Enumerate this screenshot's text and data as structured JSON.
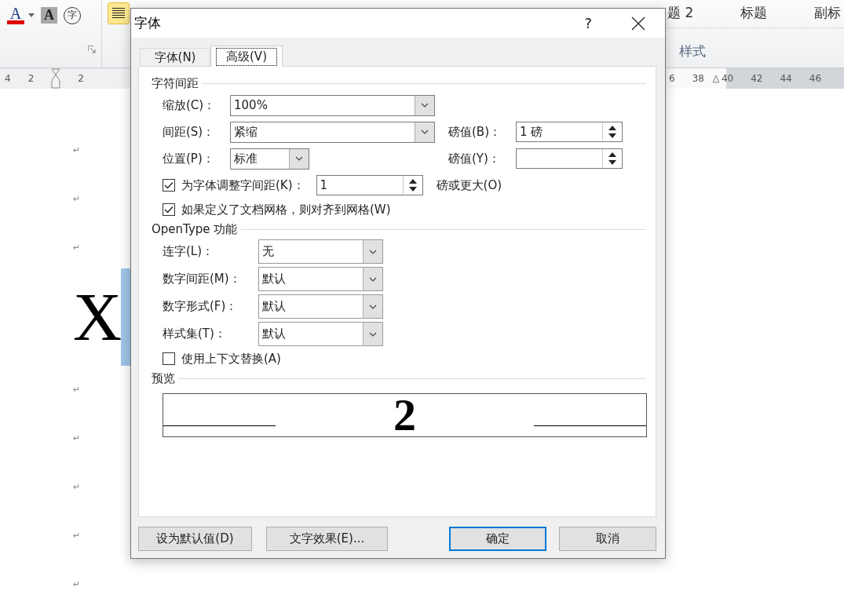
{
  "ribbon": {
    "font_tools": [
      {
        "kind": "font_color",
        "glyph": "A"
      },
      {
        "kind": "shading",
        "glyph": "A"
      },
      {
        "kind": "enclose",
        "glyph": "字"
      }
    ],
    "styles": [
      {
        "label": "题 2"
      },
      {
        "label": "标题"
      },
      {
        "label": "副标"
      }
    ],
    "group_label": "样式"
  },
  "ruler": {
    "left_numbers": [
      "4",
      "2",
      "2"
    ],
    "right_numbers": [
      "6",
      "38",
      "40",
      "42",
      "44",
      "46"
    ]
  },
  "document": {
    "lines": [
      {
        "kind": "mark",
        "text": "↵"
      },
      {
        "kind": "mark",
        "text": "↵"
      },
      {
        "kind": "mark",
        "text": "↵"
      },
      {
        "kind": "big",
        "text": "X",
        "selected": true
      },
      {
        "kind": "mark",
        "text": "↵"
      },
      {
        "kind": "mark",
        "text": "↵"
      },
      {
        "kind": "mark",
        "text": "↵"
      },
      {
        "kind": "mark",
        "text": "↵"
      },
      {
        "kind": "mark",
        "text": "↵"
      }
    ]
  },
  "dialog": {
    "title": "字体",
    "help": "?",
    "tabs": [
      {
        "label": "字体(N)",
        "selected": false
      },
      {
        "label": "高级(V)",
        "selected": true
      }
    ],
    "sections": [
      {
        "kind": "fields",
        "title": "字符间距",
        "rows": [
          {
            "kind": "combo",
            "label": "缩放(C)：",
            "value": "100%"
          },
          {
            "kind": "combo",
            "label": "间距(S)：",
            "value": "紧缩",
            "side_label": "磅值(B)：",
            "side_value": "1 磅"
          },
          {
            "kind": "combo",
            "label": "位置(P)：",
            "value": "标准",
            "side_label": "磅值(Y)："
          },
          {
            "kind": "check_spin",
            "label": "为字体调整字间距(K)：",
            "checked": true,
            "value": "1",
            "suffix": "磅或更大(O)"
          },
          {
            "kind": "check",
            "label": "如果定义了文档网格，则对齐到网格(W)",
            "checked": true
          }
        ]
      },
      {
        "kind": "fields",
        "title": "OpenType 功能",
        "rows": [
          {
            "kind": "combo",
            "label": "连字(L)：",
            "value": "无"
          },
          {
            "kind": "combo",
            "label": "数字间距(M)：",
            "value": "默认"
          },
          {
            "kind": "combo",
            "label": "数字形式(F)：",
            "value": "默认"
          },
          {
            "kind": "combo",
            "label": "样式集(T)：",
            "value": "默认"
          },
          {
            "kind": "check",
            "label": "使用上下文替换(A)",
            "checked": false
          }
        ]
      },
      {
        "kind": "preview",
        "title": "预览",
        "sample": "2"
      }
    ],
    "buttons": [
      {
        "label": "设为默认值(D)",
        "default": false
      },
      {
        "label": "文字效果(E)...",
        "default": false
      },
      {
        "label": "确定",
        "default": true
      },
      {
        "label": "取消",
        "default": false
      }
    ]
  }
}
